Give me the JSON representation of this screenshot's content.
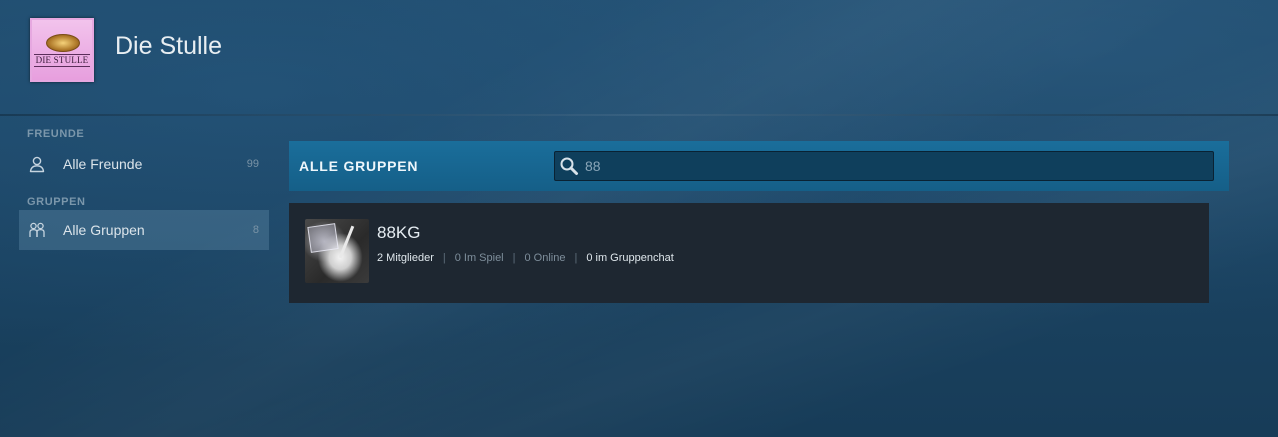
{
  "header": {
    "user_name": "Die Stulle",
    "avatar_logo_text": "DIE STULLE"
  },
  "sidebar": {
    "friends_label": "FREUNDE",
    "groups_label": "GRUPPEN",
    "items": [
      {
        "label": "Alle Freunde",
        "count": "99",
        "icon": "person-icon"
      },
      {
        "label": "Alle Gruppen",
        "count": "8",
        "icon": "group-icon",
        "active": true
      }
    ]
  },
  "main": {
    "title": "ALLE GRUPPEN",
    "search": {
      "value": "88",
      "icon": "search-icon"
    },
    "groups": [
      {
        "name": "88KG",
        "members": "2 Mitglieder",
        "in_game": "0 Im Spiel",
        "online": "0 Online",
        "in_chat": "0 im Gruppenchat"
      }
    ]
  },
  "colors": {
    "accent_bar": "#176a96",
    "card_bg": "#1e2731",
    "page_bg": "#1b4463"
  }
}
